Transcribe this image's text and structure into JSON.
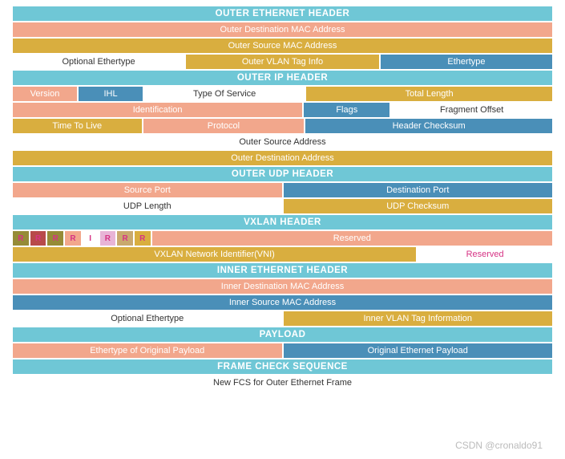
{
  "watermark": "CSDN @cronaldo91",
  "sections": {
    "outer_eth": {
      "title": "OUTER ETHERNET HEADER",
      "dst_mac": "Outer Destination MAC Address",
      "src_mac": "Outer Source MAC Address",
      "opt_ethertype": "Optional Ethertype",
      "vlan_tag": "Outer VLAN Tag Info",
      "ethertype": "Ethertype"
    },
    "outer_ip": {
      "title": "OUTER IP HEADER",
      "version": "Version",
      "ihl": "IHL",
      "tos": "Type Of Service",
      "total_len": "Total Length",
      "identification": "Identification",
      "flags": "Flags",
      "frag_off": "Fragment Offset",
      "ttl": "Time To Live",
      "protocol": "Protocol",
      "checksum": "Header Checksum",
      "src_addr": "Outer Source Address",
      "dst_addr": "Outer Destination Address"
    },
    "outer_udp": {
      "title": "OUTER UDP HEADER",
      "src_port": "Source Port",
      "dst_port": "Destination Port",
      "length": "UDP Length",
      "checksum": "UDP Checksum"
    },
    "vxlan": {
      "title": "VXLAN HEADER",
      "flags": [
        "R",
        "R",
        "R",
        "R",
        "I",
        "R",
        "R",
        "R"
      ],
      "reserved1": "Reserved",
      "vni": "VXLAN Network Identifier(VNI)",
      "reserved2": "Reserved"
    },
    "inner_eth": {
      "title": "INNER ETHERNET HEADER",
      "dst_mac": "Inner Destination MAC Address",
      "src_mac": "Inner Source MAC Address",
      "opt_ethertype": "Optional Ethertype",
      "vlan_tag": "Inner VLAN Tag Information"
    },
    "payload": {
      "title": "PAYLOAD",
      "ethertype": "Ethertype of Original Payload",
      "original": "Original Ethernet Payload"
    },
    "fcs": {
      "title": "FRAME CHECK SEQUENCE",
      "new_fcs": "New FCS for Outer Ethernet Frame"
    }
  },
  "chart_data": {
    "type": "table",
    "title": "VXLAN Encapsulation Frame Format",
    "layers": [
      {
        "name": "Outer Ethernet Header",
        "fields": [
          "Outer Destination MAC Address",
          "Outer Source MAC Address",
          "Optional Ethertype",
          "Outer VLAN Tag Info",
          "Ethertype"
        ]
      },
      {
        "name": "Outer IP Header",
        "fields": [
          "Version",
          "IHL",
          "Type Of Service",
          "Total Length",
          "Identification",
          "Flags",
          "Fragment Offset",
          "Time To Live",
          "Protocol",
          "Header Checksum",
          "Outer Source Address",
          "Outer Destination Address"
        ]
      },
      {
        "name": "Outer UDP Header",
        "fields": [
          "Source Port",
          "Destination Port",
          "UDP Length",
          "UDP Checksum"
        ]
      },
      {
        "name": "VXLAN Header",
        "fields": [
          "Flags (R R R R I R R R)",
          "Reserved",
          "VXLAN Network Identifier (VNI)",
          "Reserved"
        ]
      },
      {
        "name": "Inner Ethernet Header",
        "fields": [
          "Inner Destination MAC Address",
          "Inner Source MAC Address",
          "Optional Ethertype",
          "Inner VLAN Tag Information"
        ]
      },
      {
        "name": "Payload",
        "fields": [
          "Ethertype of Original Payload",
          "Original Ethernet Payload"
        ]
      },
      {
        "name": "Frame Check Sequence",
        "fields": [
          "New FCS for Outer Ethernet Frame"
        ]
      }
    ]
  }
}
